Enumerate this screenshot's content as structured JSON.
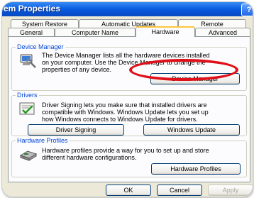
{
  "window": {
    "title": "em Properties",
    "help_glyph": "?"
  },
  "tabs_row1": [
    "System Restore",
    "Automatic Updates",
    "Remote"
  ],
  "tabs_row2": [
    "General",
    "Computer Name",
    "Hardware",
    "Advanced"
  ],
  "active_tab": "Hardware",
  "device_manager": {
    "title": "Device Manager",
    "description": [
      "The Device Manager lists all the hardware devices installed",
      "on your computer. Use the Device Manager to change the",
      "properties of any device."
    ],
    "button": "Device Manager"
  },
  "drivers": {
    "title": "Drivers",
    "description": [
      "Driver Signing lets you make sure that installed drivers are",
      "compatible with Windows. Windows Update lets you set up",
      "how Windows connects to Windows Update for drivers."
    ],
    "buttons": [
      "Driver Signing",
      "Windows Update"
    ]
  },
  "hardware_profiles": {
    "title": "Hardware Profiles",
    "description": [
      "Hardware profiles provide a way for you to set up and store",
      "different hardware configurations."
    ],
    "button": "Hardware Profiles"
  },
  "footer_buttons": {
    "ok": "OK",
    "cancel": "Cancel",
    "apply": "Apply"
  },
  "colors": {
    "annotation_ellipse": "#e0101a",
    "group_title": "#0046d5",
    "titlebar": "#0a5ee0"
  }
}
